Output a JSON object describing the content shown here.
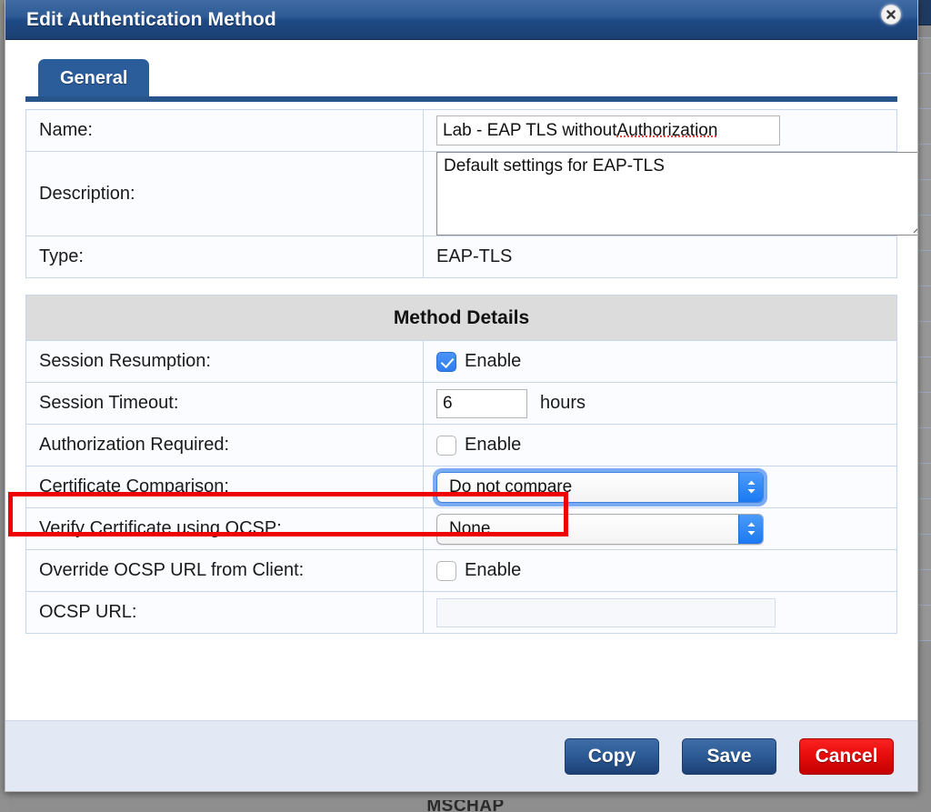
{
  "background": {
    "cutoff_label": "MSCHAP",
    "row_count": 19
  },
  "dialog": {
    "title": "Edit Authentication Method",
    "close_icon": "close-icon",
    "tabs": [
      {
        "label": "General",
        "active": true
      }
    ],
    "general": {
      "rows": [
        {
          "label": "Name:",
          "type": "text-input",
          "value": "Lab - EAP TLS without Authorization",
          "misspelled_word": "Authorization"
        },
        {
          "label": "Description:",
          "type": "textarea",
          "value": "Default settings for EAP-TLS"
        },
        {
          "label": "Type:",
          "type": "static",
          "value": "EAP-TLS"
        }
      ]
    },
    "method_details": {
      "header": "Method Details",
      "rows": [
        {
          "label": "Session Resumption:",
          "type": "checkbox",
          "checkbox_label": "Enable",
          "checked": true
        },
        {
          "label": "Session Timeout:",
          "type": "number",
          "value": "6",
          "unit": "hours"
        },
        {
          "label": "Authorization Required:",
          "type": "checkbox",
          "checkbox_label": "Enable",
          "checked": false,
          "highlighted": true
        },
        {
          "label": "Certificate Comparison:",
          "type": "select",
          "value": "Do not compare",
          "focused": true
        },
        {
          "label": "Verify Certificate using OCSP:",
          "type": "select",
          "value": "None",
          "focused": false
        },
        {
          "label": "Override OCSP URL from Client:",
          "type": "checkbox",
          "checkbox_label": "Enable",
          "checked": false
        },
        {
          "label": "OCSP URL:",
          "type": "text-input-disabled",
          "value": ""
        }
      ]
    },
    "footer": {
      "copy_label": "Copy",
      "save_label": "Save",
      "cancel_label": "Cancel"
    }
  },
  "colors": {
    "titlebar_blue": "#2f5c96",
    "tab_blue": "#2c5d9b",
    "accent_red": "#ef0000",
    "checkbox_blue": "#2f7df0",
    "footer_bg": "#e3e9f4",
    "md_header_bg": "#dcdcdc"
  }
}
